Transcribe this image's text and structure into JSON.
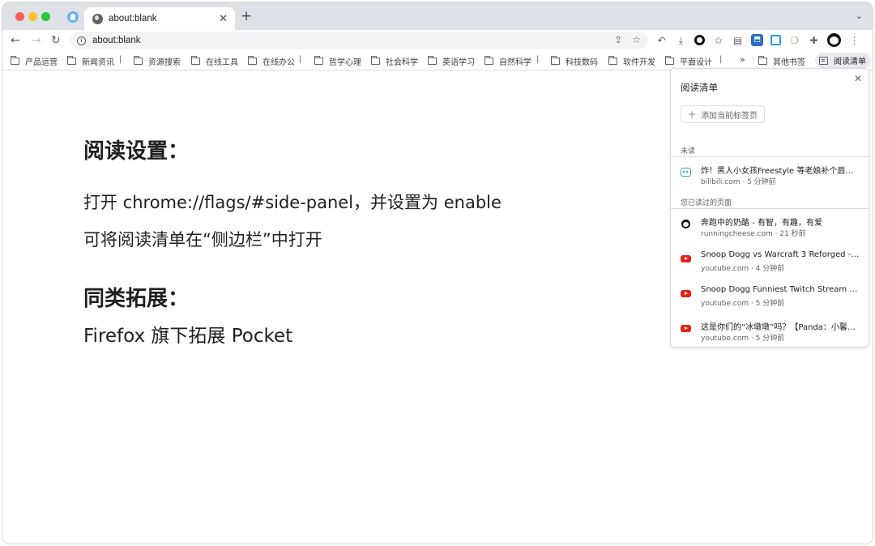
{
  "browser": {
    "tab_title": "about:blank",
    "tab_close": "✕",
    "new_tab": "+",
    "tab_search": "⌄",
    "url": "about:blank",
    "nav": {
      "back": "←",
      "forward": "→",
      "reload": "↻"
    },
    "omnibox_icons": {
      "share": "⇪",
      "bookmark": "☆"
    },
    "toolbar_icons": [
      "swirl-icon",
      "download-icon",
      "ring-icon",
      "star-plus-icon",
      "card-icon",
      "blue-extension-icon",
      "save-icon",
      "leaf-icon",
      "puzzle-icon",
      "panda-avatar",
      "more-icon"
    ],
    "bookmarks": [
      {
        "label": "产品运营"
      },
      {
        "label": "新闻资讯"
      },
      {
        "label": "资源搜索"
      },
      {
        "label": "在线工具"
      },
      {
        "label": "在线办公"
      },
      {
        "label": "哲学心理"
      },
      {
        "label": "社会科学"
      },
      {
        "label": "英语学习"
      },
      {
        "label": "自然科学"
      },
      {
        "label": "科技数码"
      },
      {
        "label": "软件开发"
      },
      {
        "label": "平面设计"
      }
    ],
    "bookmark_separator": "|",
    "bookmarks_more": "»",
    "other_bookmarks": "其他书签",
    "reading_list_button": "阅读清单"
  },
  "content": {
    "heading_settings": "阅读设置：",
    "line1": "打开 chrome://flags/#side-panel，并设置为 enable",
    "line2": "可将阅读清单在“侧边栏”中打开",
    "heading_similar": "同类拓展：",
    "line3": "Firefox 旗下拓展 Pocket"
  },
  "reading_list": {
    "title": "阅读清单",
    "close": "✕",
    "add_current": "添加当前标签页",
    "unread_label": "未读",
    "unread": [
      {
        "title": "炸！黑人小女孩Freestyle 等老娘补个唇蜜…",
        "meta": "bilibili.com · 5 分钟前",
        "icon": "bilibili-icon"
      }
    ],
    "read_label": "您已读过的页面",
    "read": [
      {
        "title": "奔跑中的奶酪 - 有智，有趣，有爱",
        "meta": "runningcheese.com · 21 秒前",
        "icon": "panda-icon"
      },
      {
        "title": "Snoop Dogg vs Warcraft 3 Reforged - You…",
        "meta": "youtube.com · 4 分钟前",
        "icon": "youtube-icon"
      },
      {
        "title": "Snoop Dogg Funniest Twitch Stream Mo…",
        "meta": "youtube.com · 5 分钟前",
        "icon": "youtube-icon"
      },
      {
        "title": "这是你们的“冰墩墩”吗？【Panda：小馨X…",
        "meta": "youtube.com · 5 分钟前",
        "icon": "youtube-icon"
      }
    ]
  }
}
